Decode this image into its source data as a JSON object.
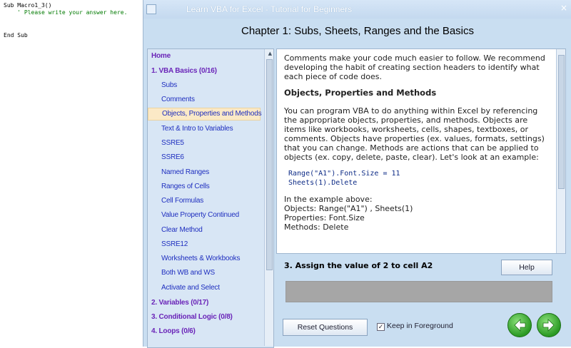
{
  "editor": {
    "lines": [
      "Sub Macro1_3()",
      "    ' Please write your answer here.",
      "",
      "End Sub"
    ]
  },
  "window": {
    "title": "Learn VBA for Excel - Tutorial for Beginners",
    "close_label": "×"
  },
  "chapter_title": "Chapter 1: Subs, Sheets, Ranges and the Basics",
  "nav": {
    "items": [
      {
        "label": "Home",
        "level": 0
      },
      {
        "label": "1. VBA Basics (0/16)",
        "level": 0
      },
      {
        "label": "Subs",
        "level": 1
      },
      {
        "label": "Comments",
        "level": 1
      },
      {
        "label": "Objects, Properties and Methods",
        "level": 1,
        "selected": true
      },
      {
        "label": "Text & Intro to Variables",
        "level": 1
      },
      {
        "label": "SSRE5",
        "level": 1
      },
      {
        "label": "SSRE6",
        "level": 1
      },
      {
        "label": "Named Ranges",
        "level": 1
      },
      {
        "label": "Ranges of Cells",
        "level": 1
      },
      {
        "label": "Cell Formulas",
        "level": 1
      },
      {
        "label": "Value Property Continued",
        "level": 1
      },
      {
        "label": "Clear Method",
        "level": 1
      },
      {
        "label": "SSRE12",
        "level": 1
      },
      {
        "label": "Worksheets & Workbooks",
        "level": 1
      },
      {
        "label": "Both WB and WS",
        "level": 1
      },
      {
        "label": "Activate and Select",
        "level": 1
      },
      {
        "label": "2. Variables (0/17)",
        "level": 0
      },
      {
        "label": "3. Conditional Logic (0/8)",
        "level": 0
      },
      {
        "label": "4. Loops (0/6)",
        "level": 0
      }
    ]
  },
  "content": {
    "intro": "Comments make your code much easier to follow. We recommend developing the habit of creating section headers to identify what each piece of code does.",
    "heading": "Objects, Properties and Methods",
    "body": "You can program VBA to do anything within Excel by referencing the appropriate objects, properties, and methods. Objects are items like workbooks, worksheets, cells, shapes, textboxes, or comments. Objects have properties (ex. values, formats, settings) that you can change. Methods are actions that can be applied to objects (ex. copy, delete, paste, clear). Let's look at an example:",
    "code_line1": "Range(\"A1\").Font.Size = 11",
    "code_line2": "Sheets(1).Delete",
    "example_intro": "In the example above:",
    "objects_line": "Objects: Range(\"A1\") , Sheets(1)",
    "properties_line": "Properties: Font.Size",
    "methods_line": "Methods: Delete"
  },
  "question": "3. Assign the value of 2 to cell A2",
  "buttons": {
    "help": "Help",
    "reset": "Reset Questions",
    "keep_foreground": "Keep in Foreground",
    "keep_checked": "✓"
  }
}
